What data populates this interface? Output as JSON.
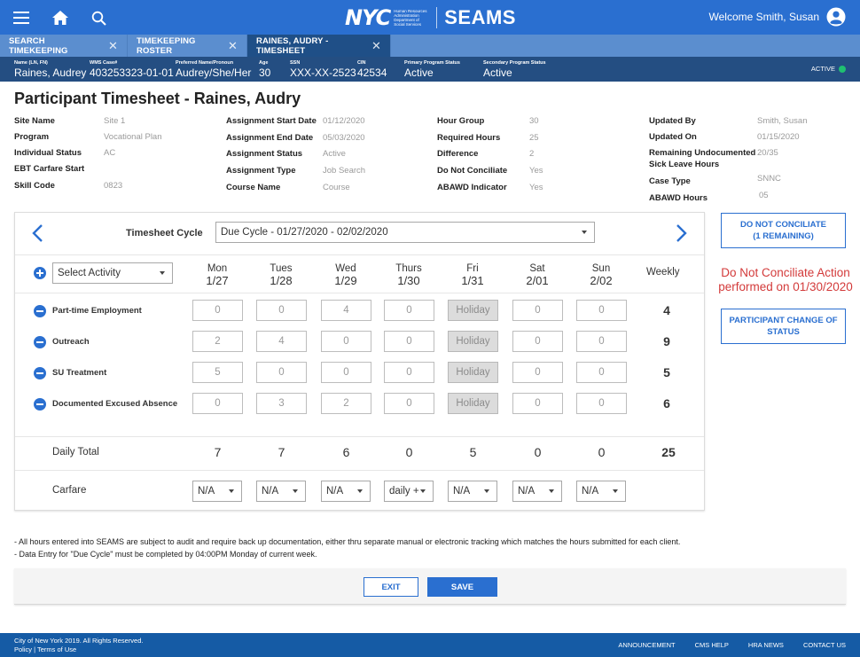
{
  "header": {
    "logo_nyc": "NYC",
    "logo_agency": [
      "Human Resources",
      "Administration",
      "Department of",
      "Social Services"
    ],
    "app_name": "SEAMS",
    "welcome": "Welcome Smith, Susan",
    "icons": {
      "menu": "hamburger-menu-icon",
      "home": "home-icon",
      "search": "search-icon",
      "user": "user-account-icon"
    }
  },
  "tabs": [
    {
      "label": "SEARCH TIMEKEEPING",
      "active": false
    },
    {
      "label": "TIMEKEEPING ROSTER",
      "active": false
    },
    {
      "label": "RAINES, AUDRY - TIMESHEET",
      "active": true
    }
  ],
  "participant": {
    "fields": [
      {
        "label": "Name (LN, FN)",
        "value": "Raines, Audrey"
      },
      {
        "label": "WMS Case#",
        "value": "403253323-01-01"
      },
      {
        "label": "Preferred Name/Pronoun",
        "value": "Audrey/She/Her"
      },
      {
        "label": "Age",
        "value": "30"
      },
      {
        "label": "SSN",
        "value": "XXX-XX-2523"
      },
      {
        "label": "CIN",
        "value": "42534"
      },
      {
        "label": "Primary Program Status",
        "value": "Active"
      },
      {
        "label": "Secondary Program Status",
        "value": "Active"
      }
    ],
    "status": "ACTIVE",
    "status_color": "#1fc071"
  },
  "page_title": "Participant Timesheet - Raines, Audry",
  "details": {
    "col1": [
      {
        "label": "Site Name",
        "value": "Site 1"
      },
      {
        "label": "Program",
        "value": "Vocational Plan"
      },
      {
        "label": "Individual Status",
        "value": "AC"
      },
      {
        "label": "EBT Carfare Start",
        "value": ""
      },
      {
        "label": "Skill Code",
        "value": "0823"
      }
    ],
    "col2": [
      {
        "label": "Assignment Start Date",
        "value": "01/12/2020"
      },
      {
        "label": "Assignment End Date",
        "value": "05/03/2020"
      },
      {
        "label": "Assignment Status",
        "value": "Active"
      },
      {
        "label": "Assignment Type",
        "value": "Job Search"
      },
      {
        "label": "Course Name",
        "value": "Course"
      }
    ],
    "col3": [
      {
        "label": "Hour Group",
        "value": "30"
      },
      {
        "label": "Required Hours",
        "value": "25"
      },
      {
        "label": "Difference",
        "value": "2"
      },
      {
        "label": "Do Not Conciliate",
        "value": "Yes"
      },
      {
        "label": "ABAWD Indicator",
        "value": "Yes"
      }
    ],
    "col4": [
      {
        "label": "Updated By",
        "value": "Smith, Susan"
      },
      {
        "label": "Updated On",
        "value": "01/15/2020"
      },
      {
        "label": "Remaining Undocumented",
        "label2": "Sick Leave Hours",
        "value": "20/35"
      },
      {
        "label": "Case Type",
        "value": "SNNC"
      },
      {
        "label": "ABAWD Hours",
        "value": "05"
      }
    ]
  },
  "timesheet": {
    "cycle_label": "Timesheet Cycle",
    "cycle_value": "Due Cycle - 01/27/2020 - 02/02/2020",
    "activity_placeholder": "Select Activity",
    "weekly_label": "Weekly",
    "days": [
      {
        "day": "Mon",
        "date": "1/27"
      },
      {
        "day": "Tues",
        "date": "1/28"
      },
      {
        "day": "Wed",
        "date": "1/29"
      },
      {
        "day": "Thurs",
        "date": "1/30"
      },
      {
        "day": "Fri",
        "date": "1/31"
      },
      {
        "day": "Sat",
        "date": "2/01"
      },
      {
        "day": "Sun",
        "date": "2/02"
      }
    ],
    "activities": [
      {
        "name": "Part-time Employment",
        "hours": [
          "0",
          "0",
          "4",
          "0",
          "Holiday",
          "0",
          "0"
        ],
        "weekly": "4"
      },
      {
        "name": "Outreach",
        "hours": [
          "2",
          "4",
          "0",
          "0",
          "Holiday",
          "0",
          "0"
        ],
        "weekly": "9"
      },
      {
        "name": "SU Treatment",
        "hours": [
          "5",
          "0",
          "0",
          "0",
          "Holiday",
          "0",
          "0"
        ],
        "weekly": "5"
      },
      {
        "name": "Documented Excused Absence",
        "hours": [
          "0",
          "3",
          "2",
          "0",
          "Holiday",
          "0",
          "0"
        ],
        "weekly": "6"
      }
    ],
    "daily_total_label": "Daily Total",
    "daily_totals": [
      "7",
      "7",
      "6",
      "0",
      "5",
      "0",
      "0"
    ],
    "weekly_total": "25",
    "carfare_label": "Carfare",
    "carfare": [
      "N/A",
      "N/A",
      "N/A",
      "daily +",
      "N/A",
      "N/A",
      "N/A"
    ]
  },
  "side": {
    "dnc_button_line1": "DO NOT CONCILIATE",
    "dnc_button_line2": "(1 REMAINING)",
    "dnc_message_line1": "Do Not Conciliate Action",
    "dnc_message_line2": "performed on 01/30/2020",
    "change_status_line1": "PARTICIPANT CHANGE OF",
    "change_status_line2": "STATUS"
  },
  "notes": [
    "- All hours entered into SEAMS are subject to audit and require back up documentation, either thru separate manual or electronic tracking which matches the hours submitted for each client.",
    "- Data Entry for \"Due Cycle\" must be completed by 04:00PM  Monday of current week."
  ],
  "actions": {
    "exit": "EXIT",
    "save": "SAVE"
  },
  "footer": {
    "copyright": "City of New York 2019. All Rights Reserved.",
    "policy": "Policy",
    "separator": " | ",
    "terms": "Terms of Use",
    "links": [
      "ANNOUNCEMENT",
      "CMS HELP",
      "HRA NEWS",
      "CONTACT US"
    ]
  },
  "colors": {
    "brand_blue": "#2a6fd0",
    "info_bar": "#244e82",
    "tab_bar": "#5b8ecf",
    "alert_red": "#d33a3a",
    "footer": "#155ba5"
  }
}
